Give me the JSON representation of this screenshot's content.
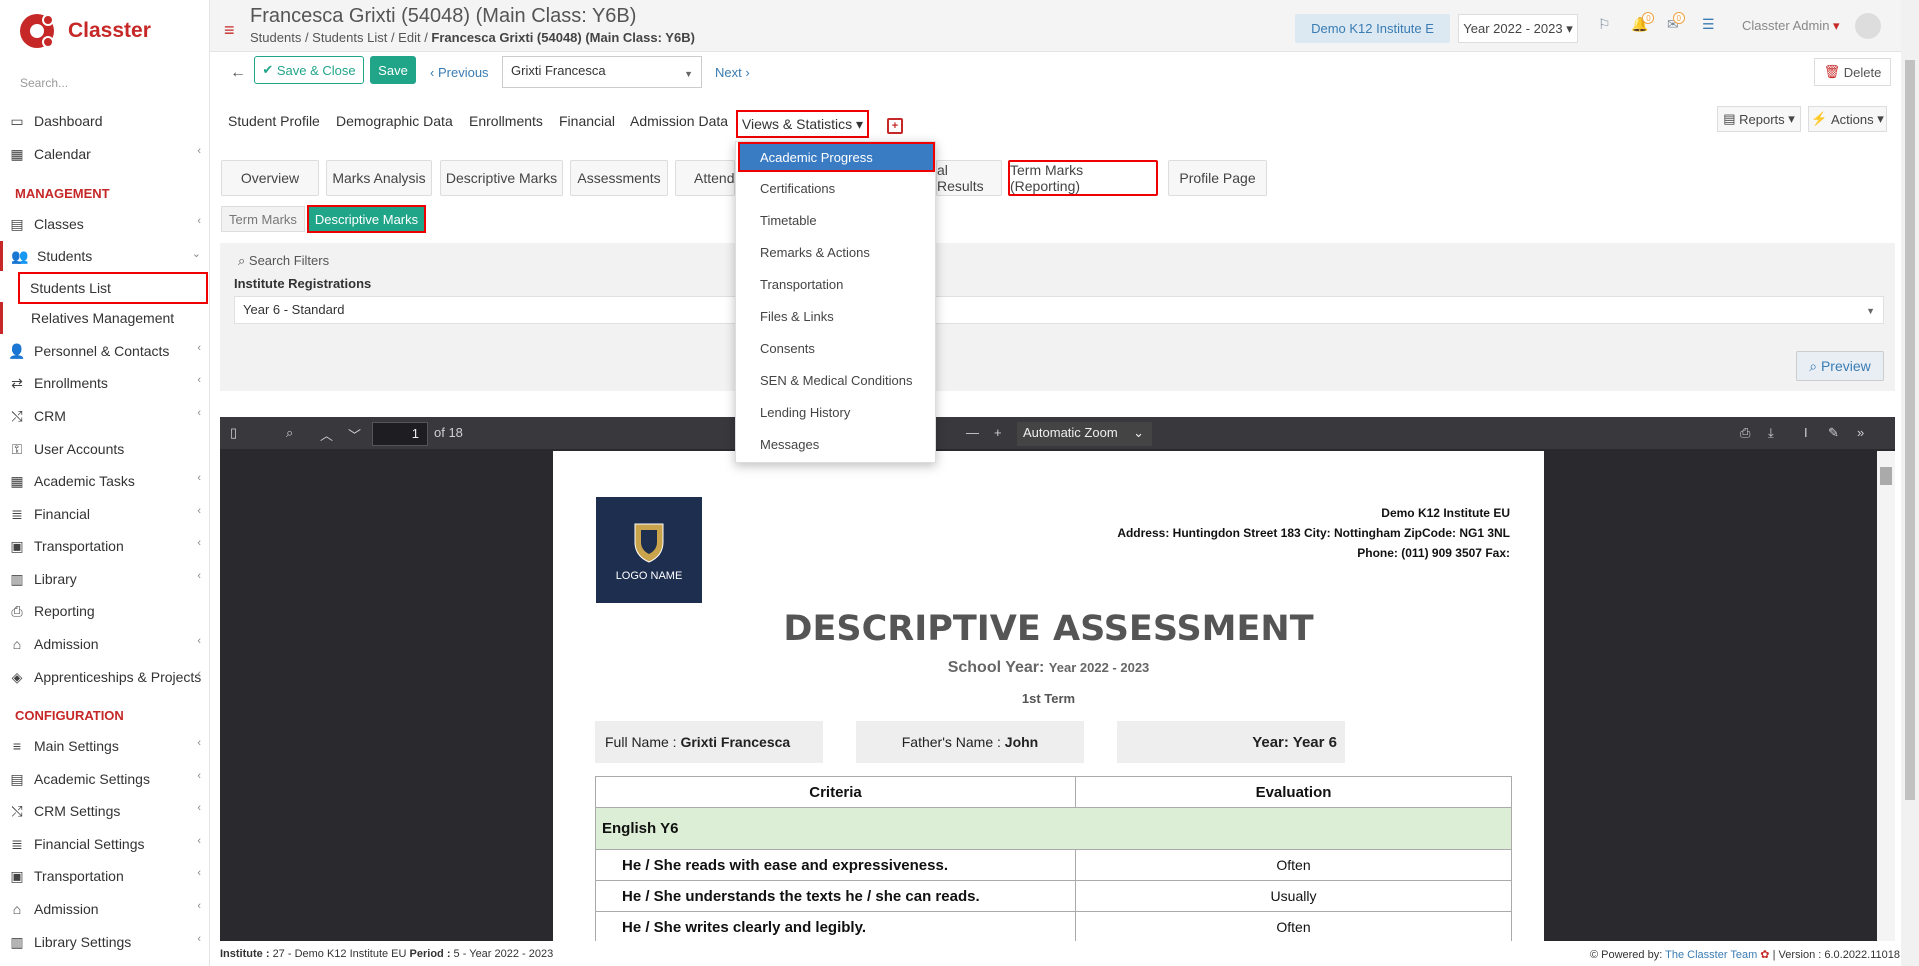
{
  "app": {
    "name": "Classter",
    "search_placeholder": "Search..."
  },
  "sidebar": {
    "items": [
      {
        "label": "Dashboard",
        "icon": "laptop-icon"
      },
      {
        "label": "Calendar",
        "icon": "calendar-icon"
      },
      {
        "label": "Classes",
        "icon": "classes-icon"
      },
      {
        "label": "Students",
        "icon": "students-icon"
      },
      {
        "label": "Personnel & Contacts",
        "icon": "personnel-icon"
      },
      {
        "label": "Enrollments",
        "icon": "enrollments-icon"
      },
      {
        "label": "CRM",
        "icon": "crm-icon"
      },
      {
        "label": "User Accounts",
        "icon": "key-icon"
      },
      {
        "label": "Academic Tasks",
        "icon": "tasks-icon"
      },
      {
        "label": "Financial",
        "icon": "financial-icon"
      },
      {
        "label": "Transportation",
        "icon": "bus-icon"
      },
      {
        "label": "Library",
        "icon": "library-icon"
      },
      {
        "label": "Reporting",
        "icon": "printer-icon"
      },
      {
        "label": "Admission",
        "icon": "institution-icon"
      },
      {
        "label": "Apprenticeships & Projects",
        "icon": "cube-icon"
      },
      {
        "label": "Main Settings",
        "icon": "settings-icon"
      },
      {
        "label": "Academic Settings",
        "icon": "academic-settings-icon"
      },
      {
        "label": "CRM Settings",
        "icon": "crm-settings-icon"
      },
      {
        "label": "Financial Settings",
        "icon": "financial-settings-icon"
      },
      {
        "label": "Transportation",
        "icon": "bus-icon"
      },
      {
        "label": "Admission",
        "icon": "institution-icon"
      },
      {
        "label": "Library Settings",
        "icon": "library-icon"
      }
    ],
    "section_management": "MANAGEMENT",
    "section_configuration": "CONFIGURATION",
    "sub_students_list": "Students List",
    "sub_relatives": "Relatives Management"
  },
  "header": {
    "title": "Francesca Grixti (54048) (Main Class: Y6B)",
    "breadcrumb": [
      "Students",
      "Students List",
      "Edit"
    ],
    "breadcrumb_current": "Francesca Grixti (54048) (Main Class: Y6B)",
    "institute": "Demo K12 Institute E",
    "year": "Year 2022 - 2023",
    "notif_count": "0",
    "mail_count": "0",
    "user": "Classter Admin"
  },
  "toolbar": {
    "save_close": "Save & Close",
    "save": "Save",
    "previous": "Previous",
    "student_select": "Grixti Francesca",
    "next": "Next",
    "delete": "Delete"
  },
  "tabs": {
    "items": [
      "Student Profile",
      "Demographic Data",
      "Enrollments",
      "Financial",
      "Admission Data"
    ],
    "active": "Views & Statistics",
    "reports": "Reports",
    "actions": "Actions"
  },
  "subtabs": {
    "overview": "Overview",
    "marks_analysis": "Marks Analysis",
    "descriptive_marks": "Descriptive Marks",
    "assessments": "Assessments",
    "attendance": "Attend",
    "final_results": "al Results",
    "term_marks_reporting": "Term Marks (Reporting)",
    "profile_page": "Profile Page",
    "level2_term_marks": "Term Marks",
    "level2_descriptive": "Descriptive Marks"
  },
  "dropdown": {
    "items": [
      "Academic Progress",
      "Certifications",
      "Timetable",
      "Remarks & Actions",
      "Transportation",
      "Files & Links",
      "Consents",
      "SEN & Medical Conditions",
      "Lending History",
      "Messages"
    ]
  },
  "filters": {
    "title": "Search Filters",
    "label": "Institute Registrations",
    "value": "Year 6 - Standard",
    "preview": "Preview"
  },
  "pdf": {
    "page": "1",
    "of_pages": "of 18",
    "zoom": "Automatic Zoom",
    "logo_text": "LOGO NAME",
    "inst_name": "Demo K12 Institute EU",
    "address": "Address: Huntingdon Street 183 City: Nottingham ZipCode: NG1 3NL",
    "phone": "Phone: (011) 909 3507 Fax:",
    "title": "DESCRIPTIVE ASSESSMENT",
    "school_year_label": "School Year:",
    "school_year": "Year 2022 - 2023",
    "term": "1st Term",
    "full_name_label": "Full Name :",
    "full_name": "Grixti Francesca",
    "father_label": "Father's Name :",
    "father": "John",
    "year_label": "Year: Year 6",
    "col_criteria": "Criteria",
    "col_evaluation": "Evaluation",
    "group": "English Y6",
    "rows": [
      {
        "criteria": "He / She reads with ease and expressiveness.",
        "evaluation": "Often"
      },
      {
        "criteria": "He / She understands the texts he / she can reads.",
        "evaluation": "Usually"
      },
      {
        "criteria": "He / She writes clearly and legibly.",
        "evaluation": "Often"
      }
    ]
  },
  "footer": {
    "institute_label": "Institute :",
    "institute": "27 - Demo K12 Institute EU",
    "period_label": "Period :",
    "period": "5 - Year 2022 - 2023",
    "powered_by": "Powered by:",
    "team": "The Classter Team",
    "version": "| Version : 6.0.2022.11018"
  },
  "colors": {
    "brand": "#c62828",
    "accent": "#21a589",
    "link": "#3a7cb3",
    "highlight_border": "#ee0000"
  }
}
